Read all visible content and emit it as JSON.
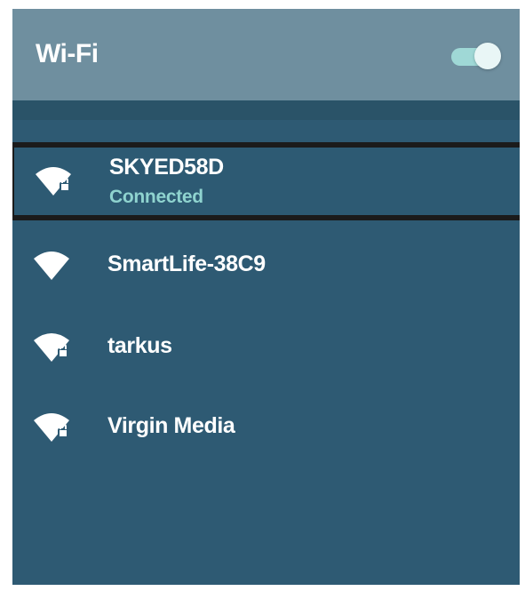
{
  "header": {
    "title": "Wi-Fi",
    "toggle_state": "on"
  },
  "colors": {
    "header_background": "#6f8f9f",
    "panel_background": "#2e5a73",
    "accent": "#8fd3cf",
    "toggle_track": "#9fd8d6",
    "highlight_border": "#1b1b1b"
  },
  "networks": [
    {
      "name": "SKYED58D",
      "status": "Connected",
      "secured": true,
      "icon": "wifi-locked-icon"
    },
    {
      "name": "SmartLife-38C9",
      "status": "",
      "secured": false,
      "icon": "wifi-icon"
    },
    {
      "name": "tarkus",
      "status": "",
      "secured": true,
      "icon": "wifi-locked-icon"
    },
    {
      "name": "Virgin Media",
      "status": "",
      "secured": true,
      "icon": "wifi-locked-icon"
    }
  ]
}
